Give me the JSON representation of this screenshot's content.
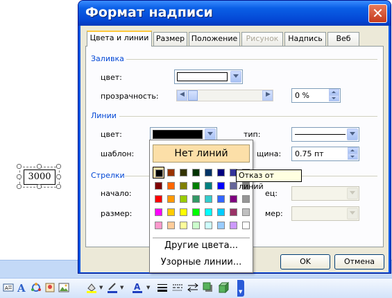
{
  "slide": {
    "textbox_value": "3000"
  },
  "dialog": {
    "title": "Формат надписи",
    "tabs": [
      {
        "label": "Цвета и линии",
        "state": "active"
      },
      {
        "label": "Размер",
        "state": "normal"
      },
      {
        "label": "Положение",
        "state": "normal"
      },
      {
        "label": "Рисунок",
        "state": "disabled"
      },
      {
        "label": "Надпись",
        "state": "normal"
      },
      {
        "label": "Веб",
        "state": "normal"
      }
    ],
    "fill": {
      "section": "Заливка",
      "color_label": "цвет:",
      "transparency_label": "прозрачность:",
      "transparency_value": "0 %",
      "transparency_level": 0
    },
    "lines": {
      "section": "Линии",
      "color_label": "цвет:",
      "type_label": "тип:",
      "pattern_label": "шаблон:",
      "weight_label": "щина:",
      "weight_value": "0.75 пт"
    },
    "arrows": {
      "section": "Стрелки",
      "start_label": "начало:",
      "end_label": "ец:",
      "size_label": "размер:",
      "size2_label": "мер:"
    },
    "ok_label": "OK",
    "cancel_label": "Отмена"
  },
  "color_popup": {
    "no_lines_label": "Нет линий",
    "more_colors_label": "Другие цвета...",
    "patterned_lines_label": "Узорные линии...",
    "tooltip": "Отказ от линий",
    "selected_color": "#000000",
    "swatches": [
      [
        "#000000",
        "#993300",
        "#333300",
        "#003300",
        "#003366",
        "#000080",
        "#333399",
        "#333333"
      ],
      [
        "#800000",
        "#ff6600",
        "#808000",
        "#008000",
        "#008080",
        "#0000ff",
        "#666699",
        "#808080"
      ],
      [
        "#ff0000",
        "#ff9900",
        "#99cc00",
        "#339966",
        "#33cccc",
        "#3366ff",
        "#800080",
        "#969696"
      ],
      [
        "#ff00ff",
        "#ffcc00",
        "#ffff00",
        "#00ff00",
        "#00ffff",
        "#00ccff",
        "#993366",
        "#c0c0c0"
      ],
      [
        "#ff99cc",
        "#ffcc99",
        "#ffff99",
        "#ccffcc",
        "#ccffff",
        "#99ccff",
        "#cc99ff",
        "#ffffff"
      ]
    ]
  },
  "toolbar": {
    "icons": [
      "textbox-icon",
      "wordart-icon",
      "diagram-icon",
      "clipart-icon",
      "picture-icon",
      "fill-color-icon",
      "line-color-icon",
      "font-color-icon",
      "line-style-icon",
      "dash-style-icon",
      "arrow-style-icon",
      "shadow-icon",
      "3d-icon"
    ]
  }
}
